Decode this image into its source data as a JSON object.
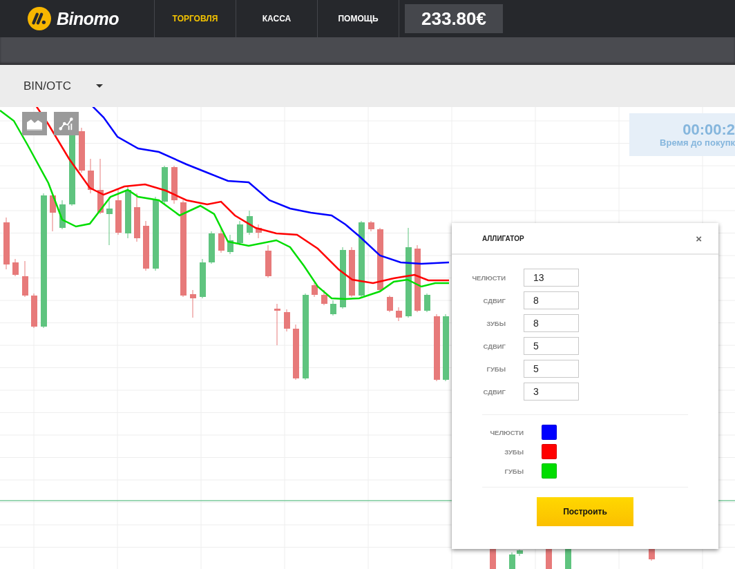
{
  "header": {
    "brand": "Binomo",
    "nav": [
      {
        "label": "ТОРГОВЛЯ",
        "selected": true
      },
      {
        "label": "КАССА",
        "selected": false
      },
      {
        "label": "ПОМОЩЬ",
        "selected": false
      }
    ],
    "balance": "233.80€"
  },
  "asset_selector": {
    "value": "BIN/OTC"
  },
  "timer": {
    "time": "00:00:2",
    "caption": "Время до покупк"
  },
  "dialog": {
    "title": "АЛЛИГАТОР",
    "close": "×",
    "fields": [
      {
        "label": "ЧЕЛЮСТИ",
        "value": "13"
      },
      {
        "label": "СДВИГ",
        "value": "8"
      },
      {
        "label": "ЗУБЫ",
        "value": "8"
      },
      {
        "label": "СДВИГ",
        "value": "5"
      },
      {
        "label": "ГУБЫ",
        "value": "5"
      },
      {
        "label": "СДВИГ",
        "value": "3"
      }
    ],
    "colors": [
      {
        "label": "ЧЕЛЮСТИ",
        "color": "#0000ff"
      },
      {
        "label": "ЗУБЫ",
        "color": "#ff0000"
      },
      {
        "label": "ГУБЫ",
        "color": "#00dd00"
      }
    ],
    "button": "Построить"
  }
}
